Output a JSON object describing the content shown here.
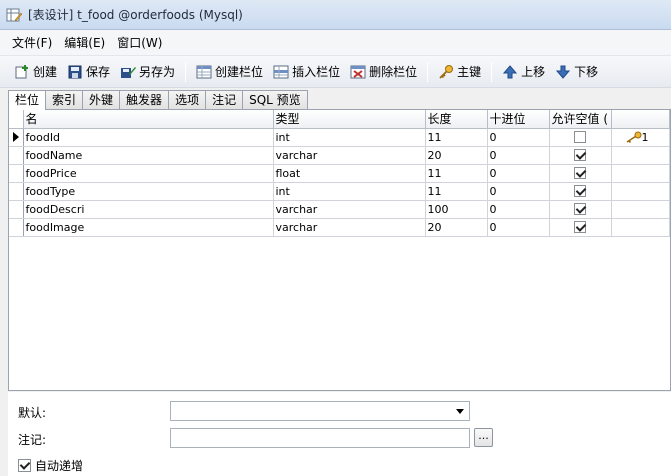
{
  "window": {
    "title": "[表设计] t_food @orderfoods (Mysql)"
  },
  "menu": {
    "items": [
      "文件(F)",
      "编辑(E)",
      "窗口(W)"
    ]
  },
  "toolbar": {
    "create": "创建",
    "save": "保存",
    "save_as": "另存为",
    "create_field": "创建栏位",
    "insert_field": "插入栏位",
    "delete_field": "删除栏位",
    "primary_key": "主键",
    "move_up": "上移",
    "move_down": "下移"
  },
  "tabs": [
    "栏位",
    "索引",
    "外键",
    "触发器",
    "选项",
    "注记",
    "SQL 预览"
  ],
  "columns": [
    "名",
    "类型",
    "长度",
    "十进位",
    "允许空值 (",
    ""
  ],
  "rows": [
    {
      "name": "foodId",
      "type": "int",
      "length": "11",
      "decimal": "0",
      "allow_null": false,
      "key": "1"
    },
    {
      "name": "foodName",
      "type": "varchar",
      "length": "20",
      "decimal": "0",
      "allow_null": true,
      "key": ""
    },
    {
      "name": "foodPrice",
      "type": "float",
      "length": "11",
      "decimal": "0",
      "allow_null": true,
      "key": ""
    },
    {
      "name": "foodType",
      "type": "int",
      "length": "11",
      "decimal": "0",
      "allow_null": true,
      "key": ""
    },
    {
      "name": "foodDescri",
      "type": "varchar",
      "length": "100",
      "decimal": "0",
      "allow_null": true,
      "key": ""
    },
    {
      "name": "foodImage",
      "type": "varchar",
      "length": "20",
      "decimal": "0",
      "allow_null": true,
      "key": ""
    }
  ],
  "props": {
    "default_label": "默认:",
    "default_value": "",
    "comment_label": "注记:",
    "comment_value": "",
    "comment_button": "...",
    "auto_increment_label": "自动递增",
    "auto_increment_checked": true
  },
  "icons": {
    "title": "table-design-icon",
    "create": "new-icon",
    "save": "save-icon",
    "save_as": "save-as-icon",
    "create_field": "create-field-icon",
    "insert_field": "insert-field-icon",
    "delete_field": "delete-field-icon",
    "primary_key": "key-icon",
    "move_up": "arrow-up-icon",
    "move_down": "arrow-down-icon"
  }
}
